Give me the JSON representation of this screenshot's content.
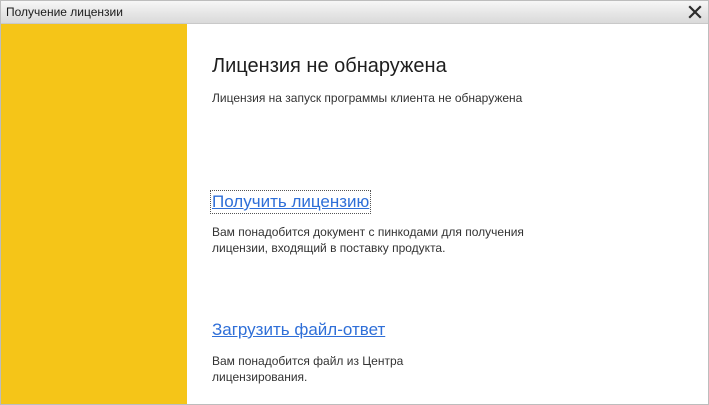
{
  "window": {
    "title": "Получение лицензии"
  },
  "icons": {
    "close": "close-icon"
  },
  "colors": {
    "side_panel": "#f5c518",
    "link": "#2f6fd8"
  },
  "main": {
    "heading": "Лицензия не обнаружена",
    "subheading": "Лицензия на запуск программы клиента не обнаружена",
    "get_license": {
      "link": "Получить лицензию",
      "desc_lines": [
        "Вам понадобится документ с пинкодами для получения",
        "лицензии, входящий в поставку продукта."
      ]
    },
    "upload_response": {
      "link": "Загрузить файл-ответ",
      "desc_lines": [
        "Вам понадобится файл из Центра",
        "лицензирования."
      ]
    }
  }
}
